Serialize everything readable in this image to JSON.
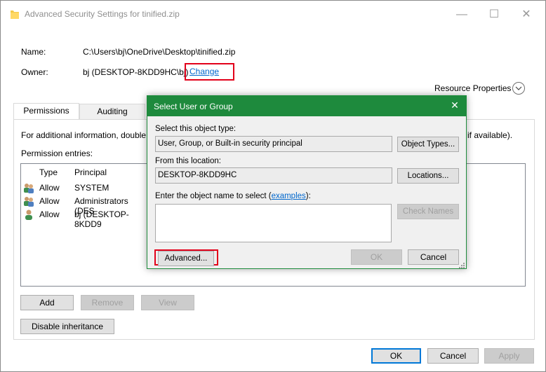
{
  "window": {
    "title": "Advanced Security Settings for tinified.zip",
    "minimize": "—",
    "maximize": "☐",
    "close": "✕"
  },
  "info": {
    "name_label": "Name:",
    "name_value": "C:\\Users\\bj\\OneDrive\\Desktop\\tinified.zip",
    "owner_label": "Owner:",
    "owner_value": "bj (DESKTOP-8KDD9HC\\bj)",
    "change_link": "Change"
  },
  "resource_properties": "Resource Properties",
  "tabs": [
    {
      "label": "Permissions"
    },
    {
      "label": "Auditing"
    }
  ],
  "permissions": {
    "info_text_left": "For additional information, double",
    "info_text_right": "if available).",
    "entries_label": "Permission entries:",
    "columns": {
      "type": "Type",
      "principal": "Principal"
    },
    "rows": [
      {
        "type": "Allow",
        "principal": "SYSTEM"
      },
      {
        "type": "Allow",
        "principal": "Administrators (DES"
      },
      {
        "type": "Allow",
        "principal": "bj (DESKTOP-8KDD9"
      }
    ],
    "add": "Add",
    "remove": "Remove",
    "view": "View",
    "disable_inheritance": "Disable inheritance"
  },
  "footer": {
    "ok": "OK",
    "cancel": "Cancel",
    "apply": "Apply"
  },
  "dialog": {
    "title": "Select User or Group",
    "close": "✕",
    "object_type_label": "Select this object type:",
    "object_type_value": "User, Group, or Built-in security principal",
    "object_types_button": "Object Types...",
    "location_label": "From this location:",
    "location_value": "DESKTOP-8KDD9HC",
    "locations_button": "Locations...",
    "enter_label_prefix": "Enter the object name to select (",
    "examples_link": "examples",
    "enter_label_suffix": "):",
    "object_name_value": "",
    "check_names_button": "Check Names",
    "advanced_button": "Advanced...",
    "ok_button": "OK",
    "cancel_button": "Cancel"
  },
  "colors": {
    "dialog_title_bg": "#1e8a3d",
    "highlight_box": "#e2001a",
    "link": "#0066cc"
  },
  "icons": [
    "folder-icon",
    "group-icon",
    "user-icon",
    "chevron-down-icon",
    "resize-grip-icon"
  ]
}
